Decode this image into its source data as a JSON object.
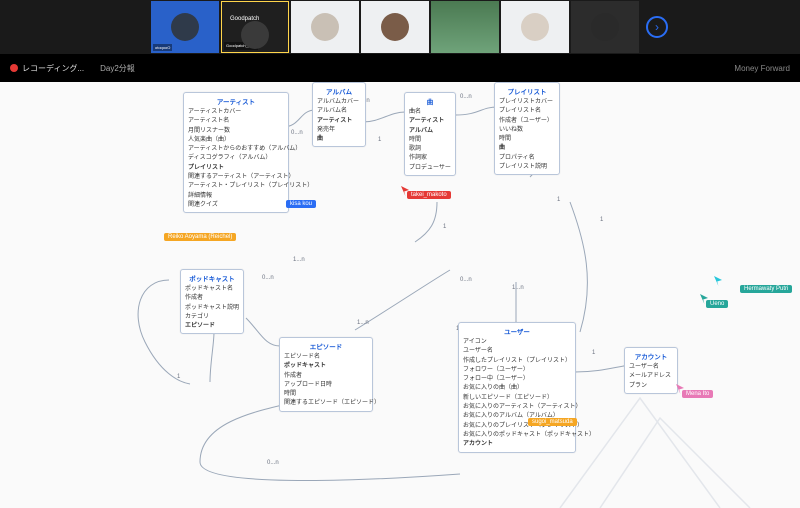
{
  "header": {
    "recording_label": "レコーディング...",
    "breadcrumb": "Day2分報",
    "right_label": "Money Forward",
    "tiles": [
      {
        "kind": "blue",
        "sub": "otoqooO"
      },
      {
        "kind": "gp",
        "brand": "Goodpatch",
        "sub": "Goodpatch_開梱"
      },
      {
        "kind": "white"
      },
      {
        "kind": "white"
      },
      {
        "kind": "green"
      },
      {
        "kind": "white"
      },
      {
        "kind": "dark"
      }
    ]
  },
  "nodes": {
    "artist": {
      "title": "アーティスト",
      "rows": [
        "アーティストカバー",
        "アーティスト名",
        "月間リスナー数",
        "人気楽曲（曲）",
        "アーティストからのおすすめ（アルバム）",
        "ディスコグラフィ（アルバム）",
        "プレイリスト",
        "関連するアーティスト（アーティスト）",
        "アーティスト・プレイリスト（プレイリスト）",
        "詳細情報",
        "関連クイズ"
      ]
    },
    "album": {
      "title": "アルバム",
      "rows": [
        "アルバムカバー",
        "アルバム名",
        "アーティスト",
        "発売年",
        "曲"
      ]
    },
    "song": {
      "title": "曲",
      "rows": [
        "曲名",
        "アーティスト",
        "アルバム",
        "時間",
        "歌詞",
        "作詞家",
        "プロデューサー"
      ]
    },
    "playlist": {
      "title": "プレイリスト",
      "rows": [
        "プレイリストカバー",
        "プレイリスト名",
        "作成者（ユーザー）",
        "いいね数",
        "時間",
        "曲",
        "プロパティ名",
        "プレイリスト説明"
      ]
    },
    "podcast": {
      "title": "ポッドキャスト",
      "rows": [
        "ポッドキャスト名",
        "作成者",
        "ポッドキャスト説明",
        "カテゴリ",
        "エピソード"
      ]
    },
    "episode": {
      "title": "エピソード",
      "rows": [
        "エピソード名",
        "ポッドキャスト",
        "作成者",
        "アップロード日時",
        "時間",
        "関連するエピソード（エピソード）"
      ]
    },
    "user": {
      "title": "ユーザー",
      "rows": [
        "アイコン",
        "ユーザー名",
        "作成したプレイリスト（プレイリスト）",
        "フォロワー（ユーザー）",
        "フォロー中（ユーザー）",
        "お気に入りの曲（曲）",
        "新しいエピソード（エピソード）",
        "お気に入りのアーティスト（アーティスト）",
        "お気に入りのアルバム（アルバム）",
        "お気に入りのプレイリスト（プレイリスト）",
        "お気に入りのポッドキャスト（ポッドキャスト）",
        "アカウント"
      ]
    },
    "account": {
      "title": "アカウント",
      "rows": [
        "ユーザー名",
        "メールアドレス",
        "プラン"
      ]
    }
  },
  "edge_labels": {
    "l1": "0...n",
    "l2": "1...n",
    "l3": "1",
    "l4": "0...n",
    "l5": "1",
    "l6": "1...n",
    "l7": "1",
    "l8": "1...n",
    "l9": "1",
    "l10": "0...n",
    "l11": "1",
    "l12": "1...n",
    "l13": "1",
    "l14": "0...n",
    "l15": "0...n",
    "l16": "1",
    "l17": "1...n"
  },
  "tags": {
    "reiko": "Reiko Aoyama (Reichel)",
    "kisa": "kisa kou",
    "takei": "takei_makoto",
    "ueno": "Ueno",
    "hermawaty": "Hermawaty Putri",
    "mena": "Mena Ito",
    "sugoi": "sugoi_matsuda"
  }
}
